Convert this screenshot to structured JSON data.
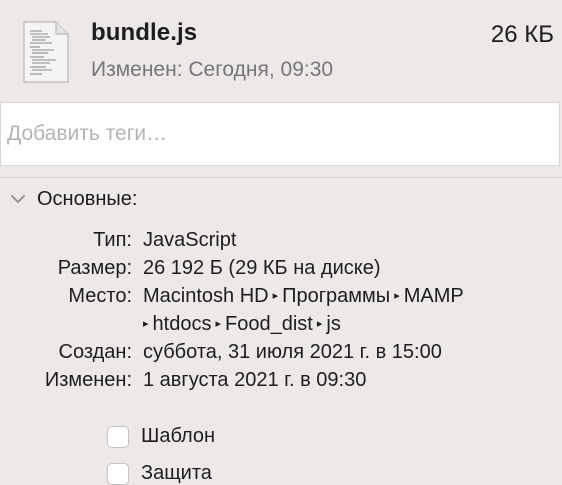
{
  "header": {
    "file_name": "bundle.js",
    "file_size": "26 КБ",
    "modified": "Изменен: Сегодня, 09:30",
    "icon": "js-document-icon"
  },
  "tags": {
    "placeholder": "Добавить теги…",
    "value": ""
  },
  "general": {
    "title": "Основные:",
    "expanded": true,
    "rows": {
      "kind": {
        "label": "Тип:",
        "value": "JavaScript"
      },
      "size": {
        "label": "Размер:",
        "value": "26 192 Б (29 КБ на диске)"
      },
      "where": {
        "label": "Место:",
        "path": [
          "Macintosh HD",
          "Программы",
          "MAMP",
          "htdocs",
          "Food_dist",
          "js"
        ]
      },
      "created": {
        "label": "Создан:",
        "value": "суббота, 31 июля 2021 г. в 15:00"
      },
      "modified": {
        "label": "Изменен:",
        "value": "1 августа 2021 г. в 09:30"
      }
    },
    "path_separator": "▸",
    "checkboxes": {
      "stationery": {
        "label": "Шаблон",
        "checked": false
      },
      "locked": {
        "label": "Защита",
        "checked": false
      }
    }
  }
}
